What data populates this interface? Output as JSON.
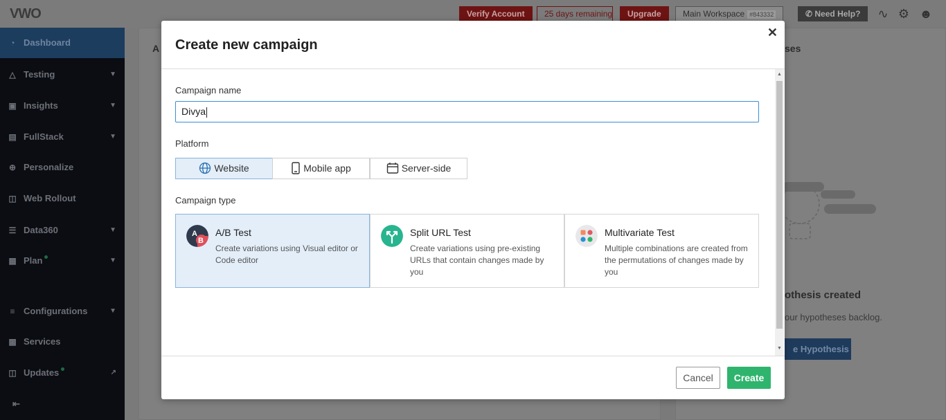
{
  "app": {
    "logo": "VWO"
  },
  "topbar": {
    "verify_label": "Verify Account",
    "remaining_label": "25 days remaining",
    "upgrade_label": "Upgrade",
    "workspace_label": "Main Workspace",
    "workspace_id": "#843332",
    "help_label": "Need Help?",
    "icons": [
      "activity-icon",
      "gear-icon",
      "user-avatar-icon"
    ]
  },
  "sidebar": {
    "items": [
      {
        "label": "Dashboard",
        "icon": "dashboard-icon",
        "active": true
      },
      {
        "label": "Testing",
        "icon": "flask-icon"
      },
      {
        "label": "Insights",
        "icon": "insights-icon"
      },
      {
        "label": "FullStack",
        "icon": "fullstack-icon"
      },
      {
        "label": "Personalize",
        "icon": "personalize-icon"
      },
      {
        "label": "Web Rollout",
        "icon": "rollout-icon"
      },
      {
        "label": "Data360",
        "icon": "database-icon"
      },
      {
        "label": "Plan",
        "icon": "calendar-icon"
      },
      {
        "label": "Configurations",
        "icon": "sliders-icon"
      },
      {
        "label": "Services",
        "icon": "briefcase-icon"
      },
      {
        "label": "Updates",
        "icon": "updates-icon"
      }
    ]
  },
  "background": {
    "card_left_title_fragment": "A",
    "card_right_title_fragment": "ses",
    "empty_title": "othesis created",
    "empty_text": "our hypotheses backlog.",
    "button_label": "e Hypothesis"
  },
  "modal": {
    "title": "Create new campaign",
    "campaign_name_label": "Campaign name",
    "campaign_name_value": "Divya",
    "platform_label": "Platform",
    "platforms": [
      {
        "label": "Website",
        "icon": "globe-icon",
        "selected": true
      },
      {
        "label": "Mobile app",
        "icon": "mobile-icon"
      },
      {
        "label": "Server-side",
        "icon": "server-icon"
      }
    ],
    "campaign_type_label": "Campaign type",
    "types": [
      {
        "title": "A/B Test",
        "desc": "Create variations using Visual editor or Code editor",
        "icon": "ab-test-icon",
        "selected": true
      },
      {
        "title": "Split URL Test",
        "desc": "Create variations using pre-existing URLs that contain changes made by you",
        "icon": "split-url-icon"
      },
      {
        "title": "Multivariate Test",
        "desc": "Multiple combinations are created from the permutations of changes made by you",
        "icon": "multivariate-icon"
      }
    ],
    "cancel_label": "Cancel",
    "create_label": "Create"
  },
  "colors": {
    "accent": "#2fb46e",
    "selected_bg": "#e3eef9",
    "focus_border": "#3a8ed4"
  }
}
